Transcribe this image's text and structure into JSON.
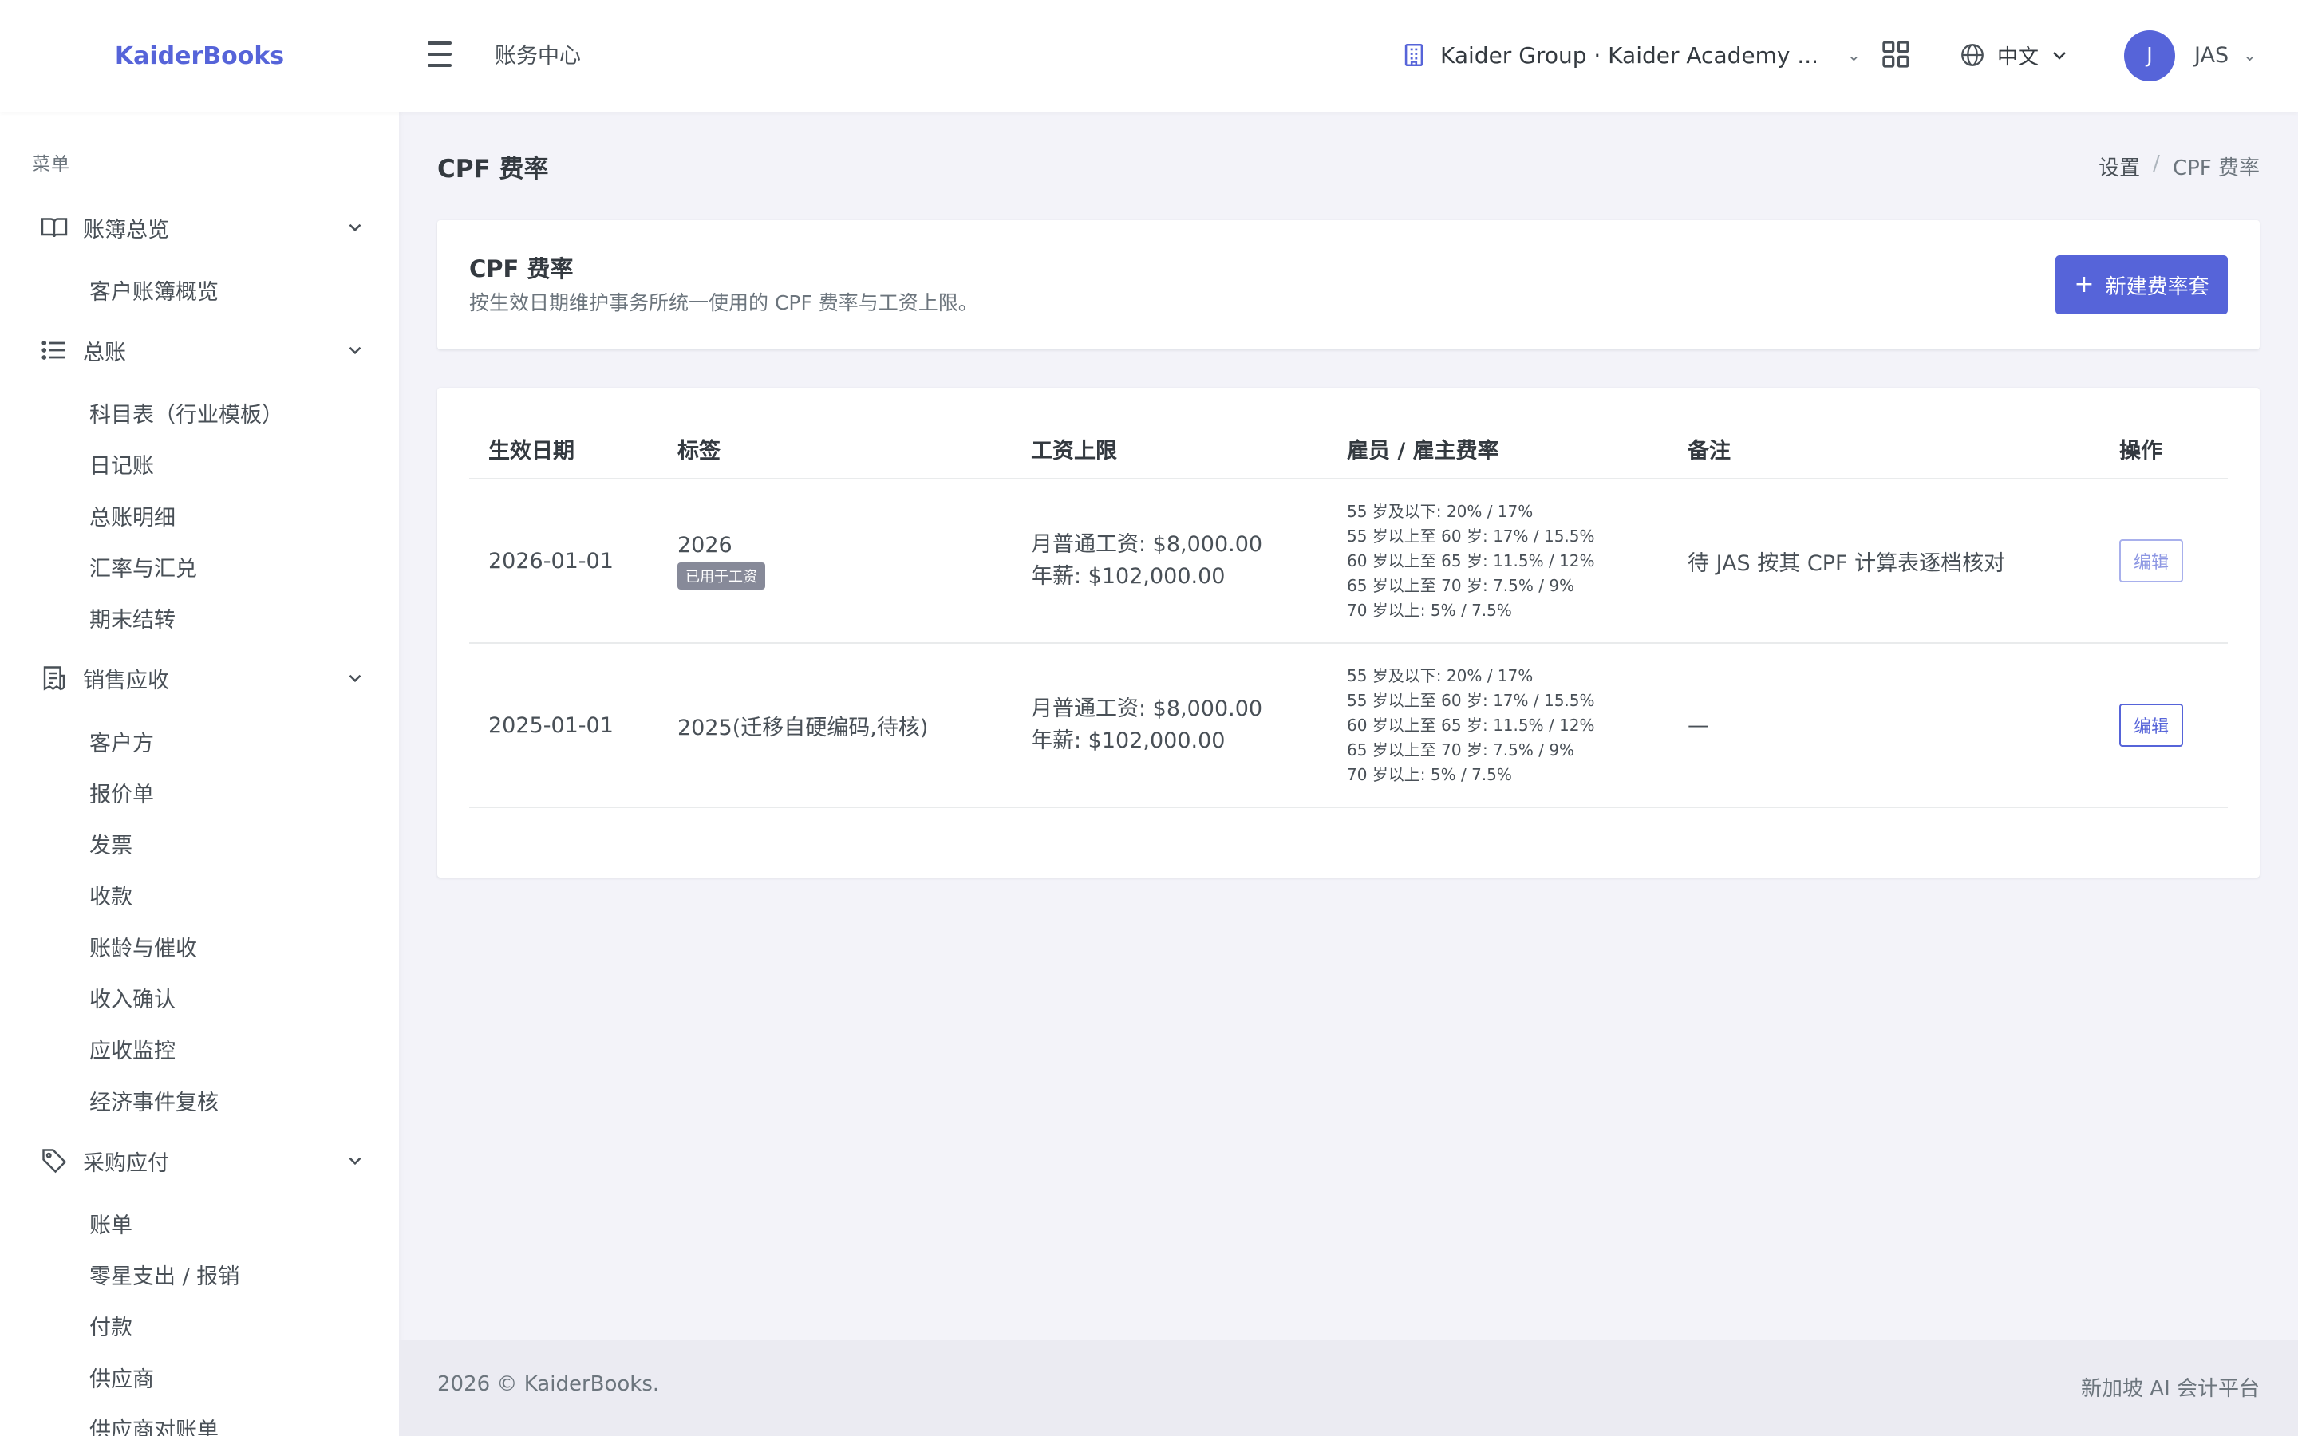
{
  "brand": "KaiderBooks",
  "header": {
    "title": "账务中心",
    "org": "Kaider Group · Kaider Academy ...",
    "lang": "中文",
    "avatar_initial": "J",
    "user": "JAS"
  },
  "sidebar": {
    "menu_title": "菜单",
    "sections": [
      {
        "label": "账簿总览",
        "icon": "book-icon",
        "items": [
          "客户账簿概览"
        ]
      },
      {
        "label": "总账",
        "icon": "list-icon",
        "items": [
          "科目表（行业模板）",
          "日记账",
          "总账明细",
          "汇率与汇兑",
          "期末结转"
        ]
      },
      {
        "label": "销售应收",
        "icon": "receipt-icon",
        "items": [
          "客户方",
          "报价单",
          "发票",
          "收款",
          "账龄与催收",
          "收入确认",
          "应收监控",
          "经济事件复核"
        ]
      },
      {
        "label": "采购应付",
        "icon": "tag-icon",
        "items": [
          "账单",
          "零星支出 / 报销",
          "付款",
          "供应商",
          "供应商对账单"
        ]
      }
    ]
  },
  "page": {
    "title": "CPF 费率",
    "breadcrumb": [
      "设置",
      "CPF 费率"
    ]
  },
  "card": {
    "title": "CPF 费率",
    "desc": "按生效日期维护事务所统一使用的 CPF 费率与工资上限。",
    "new_button": "新建费率套"
  },
  "table": {
    "headers": [
      "生效日期",
      "标签",
      "工资上限",
      "雇员 / 雇主费率",
      "备注",
      "操作"
    ],
    "rows": [
      {
        "date": "2026-01-01",
        "label": "2026",
        "badge": "已用于工资",
        "cap_monthly": "月普通工资: $8,000.00",
        "cap_annual": "年薪: $102,000.00",
        "rates": [
          "55 岁及以下: 20% / 17%",
          "55 岁以上至 60 岁: 17% / 15.5%",
          "60 岁以上至 65 岁: 11.5% / 12%",
          "65 岁以上至 70 岁: 7.5% / 9%",
          "70 岁以上: 5% / 7.5%"
        ],
        "note": "待 JAS 按其 CPF 计算表逐档核对",
        "action": "编辑"
      },
      {
        "date": "2025-01-01",
        "label": "2025(迁移自硬编码,待核)",
        "badge": "",
        "cap_monthly": "月普通工资: $8,000.00",
        "cap_annual": "年薪: $102,000.00",
        "rates": [
          "55 岁及以下: 20% / 17%",
          "55 岁以上至 60 岁: 17% / 15.5%",
          "60 岁以上至 65 岁: 11.5% / 12%",
          "65 岁以上至 70 岁: 7.5% / 9%",
          "70 岁以上: 5% / 7.5%"
        ],
        "note": "—",
        "action": "编辑"
      }
    ]
  },
  "footer": {
    "left": "2026 © KaiderBooks.",
    "right": "新加坡 AI 会计平台"
  },
  "colors": {
    "primary": "#5664d9",
    "body_bg": "#f3f3f9",
    "badge": "#878a99"
  }
}
